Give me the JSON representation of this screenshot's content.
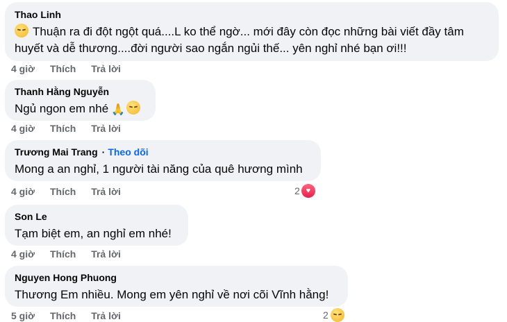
{
  "comments": [
    {
      "author": "Thao Linh",
      "text": "Thuận ra đi đột ngột quá....L ko thể ngờ... mới đây còn đọc những bài viết đầy tâm huyết và dễ thương....đời người sao ngắn ngủi thế... yên nghỉ nhé bạn ơi!!!",
      "time": "4 giờ",
      "like": "Thích",
      "reply": "Trả lời"
    },
    {
      "author": "Thanh Hằng Nguyễn",
      "text": "Ngủ ngon em nhé",
      "time": "4 giờ",
      "like": "Thích",
      "reply": "Trả lời"
    },
    {
      "author": "Trương Mai Trang",
      "follow": "Theo dõi",
      "dot": "·",
      "text": "Mong a an nghỉ, 1 người tài năng của quê hương mình",
      "time": "4 giờ",
      "like": "Thích",
      "reply": "Trả lời",
      "reaction_count": "2"
    },
    {
      "author": "Son Le",
      "text": "Tạm biệt em, an nghỉ em nhé!",
      "time": "4 giờ",
      "like": "Thích",
      "reply": "Trả lời"
    },
    {
      "author": "Nguyen Hong Phuong",
      "text": "Thương Em nhiều. Mong em yên nghỉ về nơi cõi Vĩnh hằng!",
      "time": "5 giờ",
      "like": "Thích",
      "reply": "Trả lời",
      "reaction_count": "2"
    }
  ],
  "icons": {
    "sad_emoji": "disappointed-face",
    "hands_emoji": "folded-hands",
    "face_emoji": "tearful-face",
    "heart": "love-reaction",
    "care": "care-reaction"
  },
  "colors": {
    "bubble": "#f0f2f5",
    "follow": "#0866ff",
    "meta": "#65676b"
  }
}
